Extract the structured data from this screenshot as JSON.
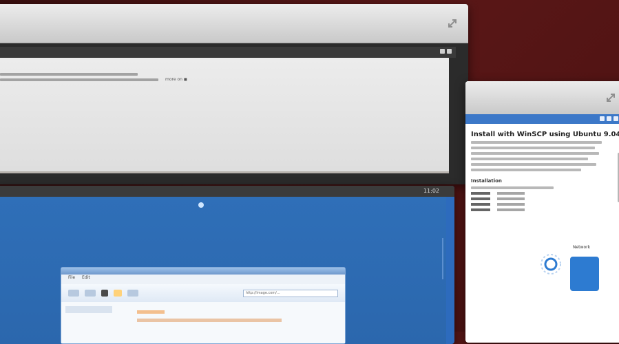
{
  "windows": {
    "top_left": {
      "maximize_icon": "maximize-icon",
      "link_text": "more on ◼"
    },
    "bottom_left": {
      "clock": "11:02",
      "menu": [
        "File",
        "Edit"
      ],
      "toolbar": {
        "url_text": "http://image.com/..."
      }
    },
    "right": {
      "maximize_icon": "maximize-icon",
      "title": "Install with WinSCP using Ubuntu 9.04",
      "section_heading": "Installation",
      "label": "Network"
    }
  }
}
